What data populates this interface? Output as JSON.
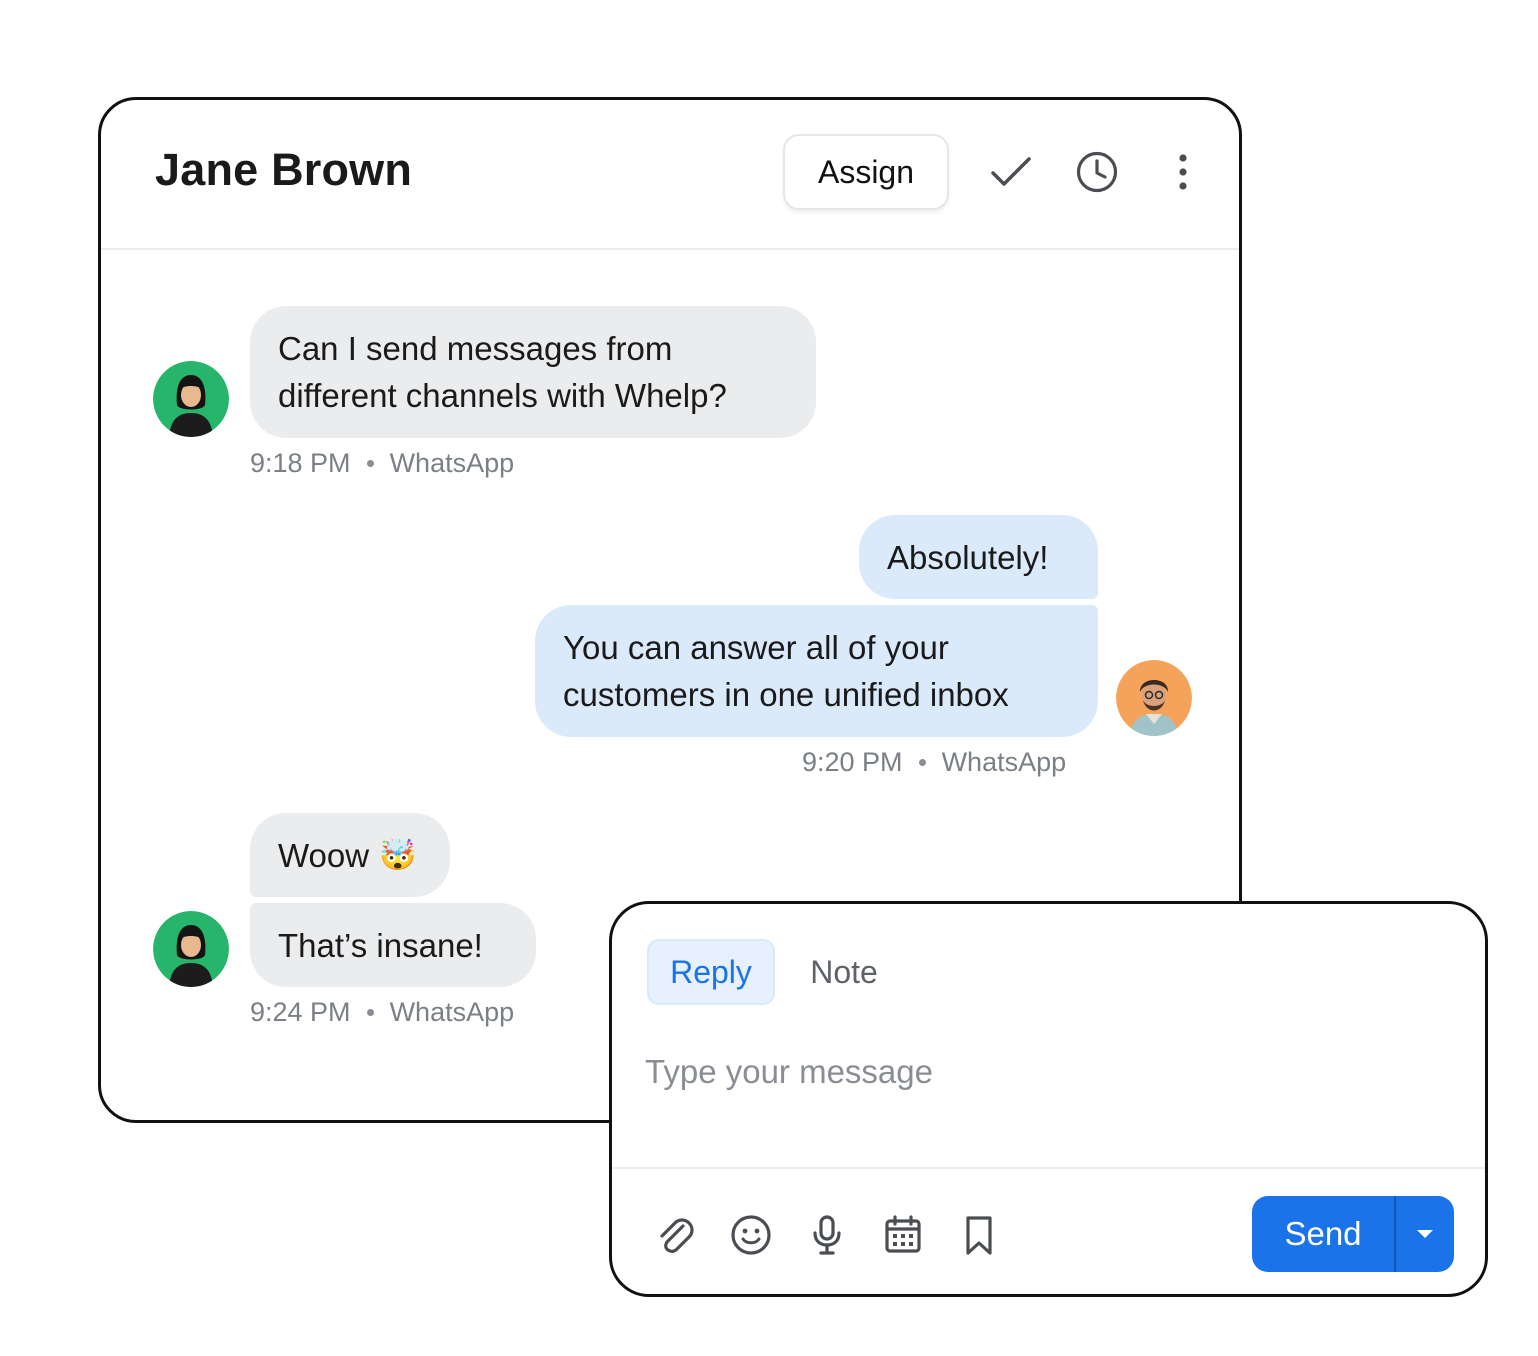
{
  "header": {
    "contact_name": "Jane Brown",
    "assign_label": "Assign"
  },
  "messages": [
    {
      "direction": "incoming",
      "lines": [
        "Can I send messages from",
        "different channels with Whelp?"
      ],
      "time": "9:18 PM",
      "channel": "WhatsApp"
    },
    {
      "direction": "outgoing",
      "text": "Absolutely!"
    },
    {
      "direction": "outgoing",
      "lines": [
        "You can answer all of your",
        "customers in one unified inbox"
      ],
      "time": "9:20 PM",
      "channel": "WhatsApp"
    },
    {
      "direction": "incoming",
      "text": "Woow",
      "emoji": "🤯"
    },
    {
      "direction": "incoming",
      "text": "That’s insane!",
      "time": "9:24 PM",
      "channel": "WhatsApp"
    }
  ],
  "composer": {
    "tabs": [
      "Reply",
      "Note"
    ],
    "active_tab": "Reply",
    "placeholder": "Type your message",
    "send_label": "Send",
    "tools": [
      "paperclip-icon",
      "smiley-icon",
      "microphone-icon",
      "calendar-icon",
      "bookmark-icon"
    ]
  },
  "colors": {
    "accent": "#1a73e8",
    "incoming_bubble": "#ebecee",
    "outgoing_bubble": "#dbeafb",
    "customer_avatar_bg": "#26b56a",
    "agent_avatar_bg": "#f5a35a"
  }
}
